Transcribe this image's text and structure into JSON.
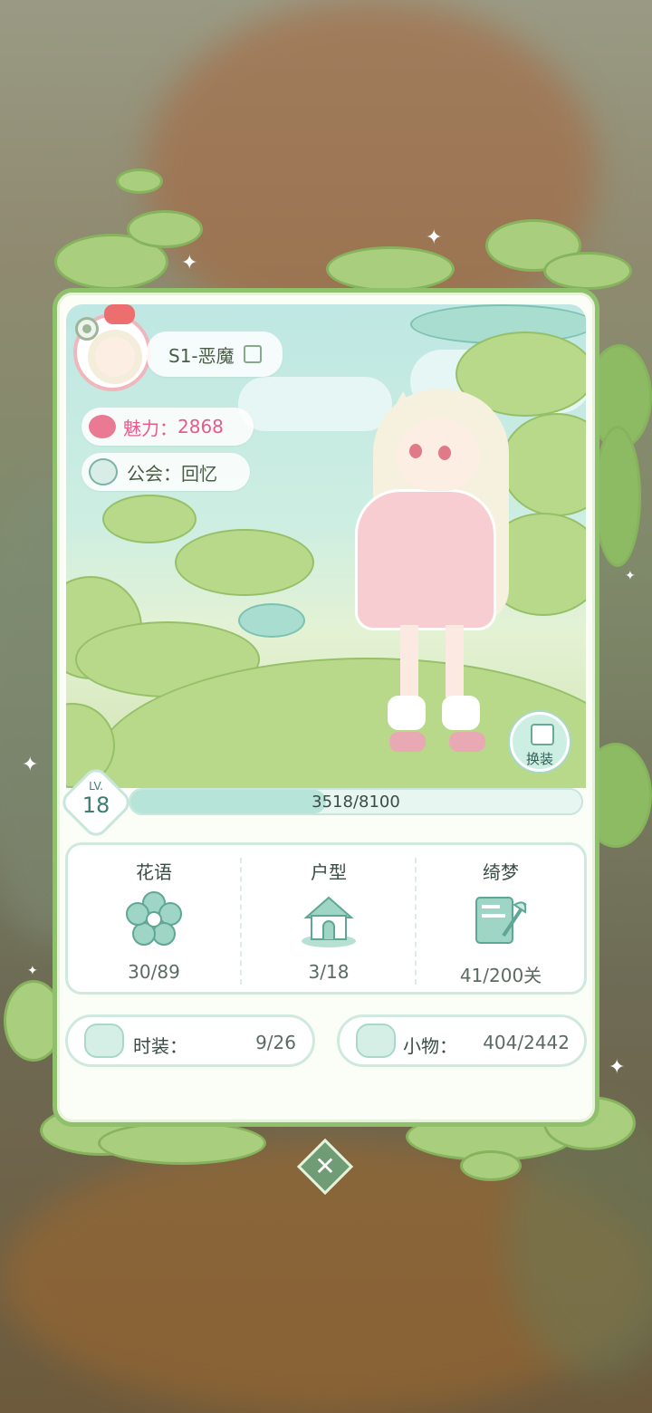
{
  "profile": {
    "name": "S1-恶魔",
    "charm_label": "魅力：",
    "charm_value": "2868",
    "guild_label": "公会：",
    "guild_value": "回忆"
  },
  "level": {
    "prefix": "LV.",
    "value": "18",
    "exp_text": "3518/8100",
    "exp_current": 3518,
    "exp_max": 8100
  },
  "outfit_button_label": "换装",
  "stats": [
    {
      "label": "花语",
      "value": "30/89",
      "icon": "flower-icon"
    },
    {
      "label": "户型",
      "value": "3/18",
      "icon": "house-icon"
    },
    {
      "label": "绮梦",
      "value": "41/200关",
      "icon": "dream-card-icon"
    }
  ],
  "collections": {
    "fashion": {
      "label": "时装：",
      "value": "9/26",
      "icon": "shirt-icon"
    },
    "items": {
      "label": "小物：",
      "value": "404/2442",
      "icon": "sofa-icon"
    }
  },
  "colors": {
    "charm": "#e85a8a",
    "panel_border": "#8fc06b",
    "accent_teal": "#3f7d74"
  }
}
